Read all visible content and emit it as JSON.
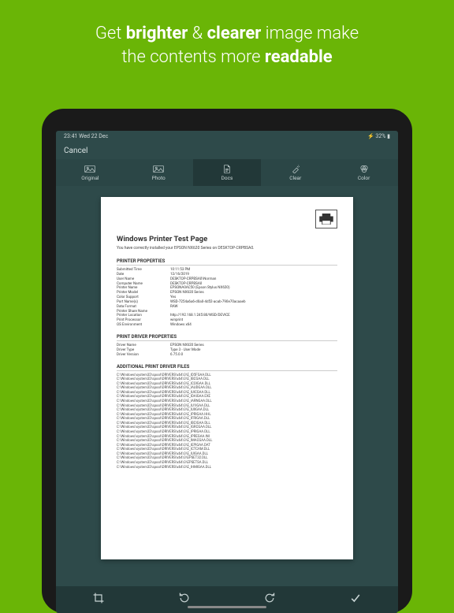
{
  "marketing": {
    "line1_pre": "Get ",
    "line1_b1": "brighter",
    "line1_mid": " & ",
    "line1_b2": "clearer",
    "line1_post": " image make",
    "line2_pre": "the contents more ",
    "line2_b": "readable"
  },
  "statusbar": {
    "time": "23:41  Wed 22 Dec",
    "battery": "32%"
  },
  "topbar": {
    "cancel": "Cancel"
  },
  "tabs": [
    {
      "label": "Original"
    },
    {
      "label": "Photo"
    },
    {
      "label": "Docs"
    },
    {
      "label": "Clear"
    },
    {
      "label": "Color"
    }
  ],
  "doc": {
    "title": "Windows Printer Test Page",
    "subtitle": "You have correctly installed your EPSON NX620 Series on DESKTOP-CRPBSA0.",
    "sections": {
      "printer_properties": "PRINTER PROPERTIES",
      "driver_properties": "PRINT DRIVER PROPERTIES",
      "additional_files": "ADDITIONAL PRINT DRIVER FILES"
    },
    "printer_props": [
      {
        "label": "Submitted Time",
        "value": "10:11:53 PM"
      },
      {
        "label": "Date",
        "value": "12/16/2019"
      },
      {
        "label": "User Name",
        "value": "DESKTOP-CRPBSA0\\Norman"
      },
      {
        "label": "Computer Name",
        "value": "DESKTOP-CRPBSA0"
      },
      {
        "label": "Printer Name",
        "value": "EPSONA0AC50 (Epson Stylus NX620)"
      },
      {
        "label": "Printer Model",
        "value": "EPSON NX620 Series"
      },
      {
        "label": "Color Support",
        "value": "Yes"
      },
      {
        "label": "Port Name(s)",
        "value": "WSD-7254a6a6-d0a0-4d52-acab-790e70acaaeb"
      },
      {
        "label": "Data Format",
        "value": "RAW"
      },
      {
        "label": "Printer Share Name",
        "value": ""
      },
      {
        "label": "Printer Location",
        "value": "http://192.168.1.245:80/WSD/DEVICE"
      },
      {
        "label": "Print Processor",
        "value": "winprint"
      },
      {
        "label": "OS Environment",
        "value": "Windows x64"
      }
    ],
    "driver_props": [
      {
        "label": "Driver Name",
        "value": "EPSON NX620 Series"
      },
      {
        "label": "Driver Type",
        "value": "Type 3 - User Mode"
      },
      {
        "label": "Driver Version",
        "value": "6.75.0.0"
      }
    ],
    "files": [
      "C:\\Windows\\system32\\spool\\DRIVERS\\x64\\3\\E_ID5FGAA.DLL",
      "C:\\Windows\\system32\\spool\\DRIVERS\\x64\\3\\E_IBCGAA.DLL",
      "C:\\Windows\\system32\\spool\\DRIVERS\\x64\\3\\E_ICOIGAA.DLL",
      "C:\\Windows\\system32\\spool\\DRIVERS\\x64\\3\\E_IAUDGAA.DLL",
      "C:\\Windows\\system32\\spool\\DRIVERS\\x64\\3\\E_IUICGAA.DLL",
      "C:\\Windows\\system32\\spool\\DRIVERS\\x64\\3\\E_IDAIGAA.EXE",
      "C:\\Windows\\system32\\spool\\DRIVERS\\x64\\3\\E_IARNGAA.DLL",
      "C:\\Windows\\system32\\spool\\DRIVERS\\x64\\3\\E_IU1IGAA.DLL",
      "C:\\Windows\\system32\\spool\\DRIVERS\\x64\\3\\E_IUIIGAA.DLL",
      "C:\\Windows\\system32\\spool\\DRIVERS\\x64\\3\\E_IPRIGAA.HHL",
      "C:\\Windows\\system32\\spool\\DRIVERS\\x64\\3\\E_IFRIGAA.DLL",
      "C:\\Windows\\system32\\spool\\DRIVERS\\x64\\3\\E_IBCIGAA.DLL",
      "C:\\Windows\\system32\\spool\\DRIVERS\\x64\\3\\E_IGRCGAA.DLL",
      "C:\\Windows\\system32\\spool\\DRIVERS\\x64\\3\\E_IPRIGAA.DLL",
      "C:\\Windows\\system32\\spool\\DRIVERS\\x64\\3\\E_IPREGAA.INI",
      "C:\\Windows\\system32\\spool\\DRIVERS\\x64\\3\\E_IMACGAA.DLL",
      "C:\\Windows\\system32\\spool\\DRIVERS\\x64\\3\\E_IEPIGAA.DAT",
      "C:\\Windows\\system32\\spool\\DRIVERS\\x64\\3\\E_ICTCAM.DLL",
      "C:\\Windows\\system32\\spool\\DRIVERS\\x64\\3\\E_IUIGAA.DLL",
      "C:\\Windows\\system32\\spool\\DRIVERS\\x64\\3\\EPSET32.DLL",
      "C:\\Windows\\system32\\spool\\DRIVERS\\x64\\3\\EPSETSA.DLL",
      "C:\\Windows\\system32\\spool\\DRIVERS\\x64\\3\\E_IHMIGAA.DLL"
    ]
  }
}
